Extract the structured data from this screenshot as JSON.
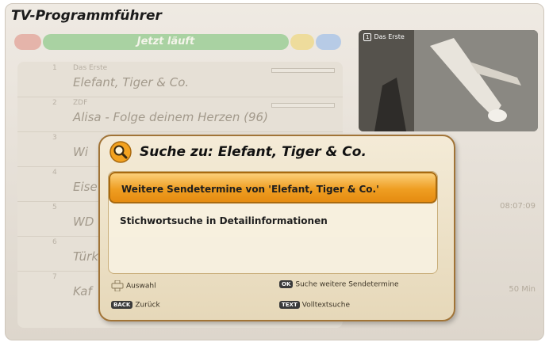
{
  "app": {
    "title": "TV-Programmführer"
  },
  "color_bar": {
    "center_label": "Jetzt läuft"
  },
  "program_list": [
    {
      "num": "1",
      "sub": "Das Erste",
      "title": "Elefant, Tiger & Co."
    },
    {
      "num": "2",
      "sub": "ZDF",
      "title": "Alisa - Folge deinem Herzen (96)"
    },
    {
      "num": "3",
      "sub": "",
      "title": "Wi"
    },
    {
      "num": "4",
      "sub": "",
      "title": "Eise"
    },
    {
      "num": "5",
      "sub": "",
      "title": "WD"
    },
    {
      "num": "6",
      "sub": "",
      "title": "Türk"
    },
    {
      "num": "7",
      "sub": "",
      "title": "Kaf"
    }
  ],
  "preview": {
    "channel": "Das Erste",
    "logo": "1"
  },
  "side_info": {
    "time1": "08:07:09",
    "time2": "50 Min"
  },
  "dialog": {
    "title": "Suche zu: Elefant, Tiger & Co.",
    "options": [
      "Weitere Sendetermine von 'Elefant, Tiger & Co.'",
      "Stichwortsuche in Detailinformationen"
    ],
    "legend": {
      "select_label": "Auswahl",
      "ok_key": "OK",
      "ok_label": "Suche weitere Sendetermine",
      "back_key": "BACK",
      "back_label": "Zurück",
      "text_key": "TEXT",
      "text_label": "Volltextsuche"
    }
  }
}
